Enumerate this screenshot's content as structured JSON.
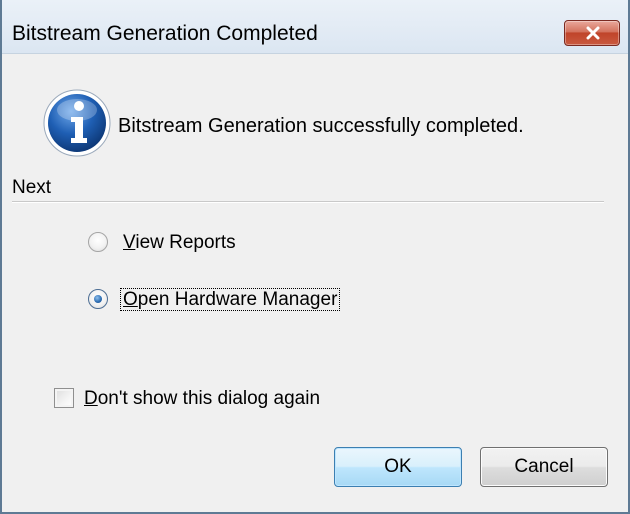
{
  "window": {
    "title": "Bitstream Generation Completed",
    "close_icon": "close-icon"
  },
  "message": {
    "icon": "info-icon",
    "text": "Bitstream Generation successfully completed."
  },
  "next_group": {
    "label": "Next",
    "options": [
      {
        "mnemonic": "V",
        "rest": "iew Reports",
        "selected": false
      },
      {
        "mnemonic": "O",
        "rest": "pen Hardware Manager",
        "selected": true
      }
    ]
  },
  "dont_show": {
    "mnemonic": "D",
    "rest": "on't show this dialog again",
    "checked": false
  },
  "buttons": {
    "ok_label": "OK",
    "cancel_label": "Cancel"
  },
  "colors": {
    "close_button": "#c0442a",
    "ok_border": "#3c7fb1",
    "info_icon_blue": "#1f5fb4"
  }
}
